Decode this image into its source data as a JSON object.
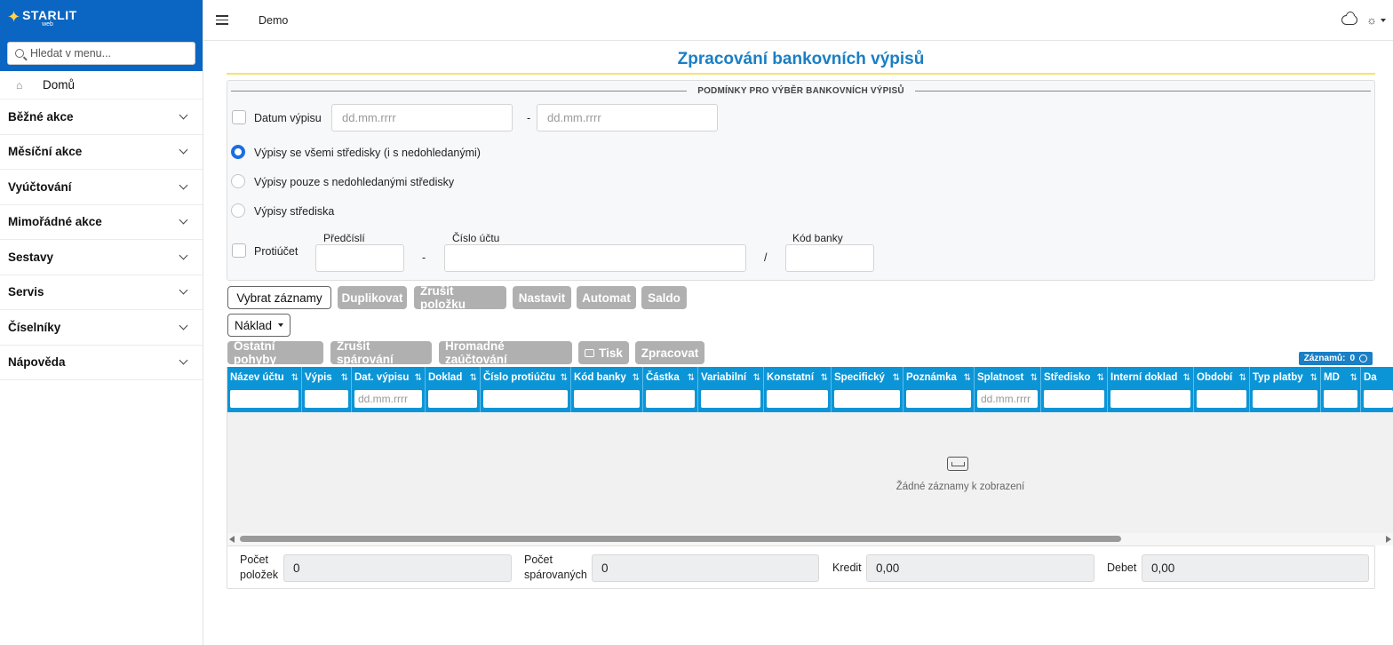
{
  "brand": {
    "name": "STARLIT",
    "sub": "web"
  },
  "sidebar": {
    "search_placeholder": "Hledat v menu...",
    "home": "Domů",
    "items": [
      {
        "label": "Běžné akce"
      },
      {
        "label": "Měsíční akce"
      },
      {
        "label": "Vyúčtování"
      },
      {
        "label": "Mimořádné akce"
      },
      {
        "label": "Sestavy"
      },
      {
        "label": "Servis"
      },
      {
        "label": "Číselníky"
      },
      {
        "label": "Nápověda"
      }
    ]
  },
  "topbar": {
    "title": "Demo"
  },
  "page": {
    "title": "Zpracování bankovních výpisů"
  },
  "filters": {
    "legend": "PODMÍNKY PRO VÝBĚR BANKOVNÍCH VÝPISŮ",
    "date_label": "Datum výpisu",
    "date_from_placeholder": "dd.mm.rrrr",
    "date_to_placeholder": "dd.mm.rrrr",
    "date_sep": "-",
    "radio_all": "Výpisy se všemi středisky (i s nedohledanými)",
    "radio_unfound": "Výpisy pouze s nedohledanými středisky",
    "radio_center": "Výpisy střediska",
    "counter_label": "Protiúčet",
    "prefix_label": "Předčíslí",
    "prefix_sep": "-",
    "account_label": "Číslo účtu",
    "bank_sep": "/",
    "bank_label": "Kód banky"
  },
  "toolbar": {
    "select": "Vybrat záznamy",
    "duplicate": "Duplikovat",
    "cancel_item": "Zrušit položku",
    "set": "Nastavit",
    "automat": "Automat",
    "saldo": "Saldo",
    "cost": "Náklad",
    "other_moves": "Ostatní pohyby",
    "cancel_pair": "Zrušit spárování",
    "bulk_post": "Hromadné zaúčtování",
    "print": "Tisk",
    "process": "Zpracovat"
  },
  "records": {
    "label": "Záznamů:",
    "count": "0"
  },
  "table": {
    "columns": [
      {
        "label": "Název účtu",
        "filter": ""
      },
      {
        "label": "Výpis",
        "filter": ""
      },
      {
        "label": "Dat. výpisu",
        "filter": "dd.mm.rrrr"
      },
      {
        "label": "Doklad",
        "filter": ""
      },
      {
        "label": "Číslo protiúčtu",
        "filter": ""
      },
      {
        "label": "Kód banky",
        "filter": ""
      },
      {
        "label": "Částka",
        "filter": ""
      },
      {
        "label": "Variabilní",
        "filter": ""
      },
      {
        "label": "Konstatní",
        "filter": ""
      },
      {
        "label": "Specifický",
        "filter": ""
      },
      {
        "label": "Poznámka",
        "filter": ""
      },
      {
        "label": "Splatnost",
        "filter": "dd.mm.rrrr"
      },
      {
        "label": "Středisko",
        "filter": ""
      },
      {
        "label": "Interní doklad",
        "filter": ""
      },
      {
        "label": "Období",
        "filter": ""
      },
      {
        "label": "Typ platby",
        "filter": ""
      },
      {
        "label": "MD",
        "filter": ""
      },
      {
        "label": "Da",
        "filter": ""
      }
    ],
    "empty_text": "Žádné záznamy k zobrazení"
  },
  "summary": {
    "items_label_1": "Počet",
    "items_label_2": "položek",
    "items_value": "0",
    "paired_label_1": "Počet",
    "paired_label_2": "spárovaných",
    "paired_value": "0",
    "credit_label": "Kredit",
    "credit_value": "0,00",
    "debit_label": "Debet",
    "debit_value": "0,00"
  }
}
